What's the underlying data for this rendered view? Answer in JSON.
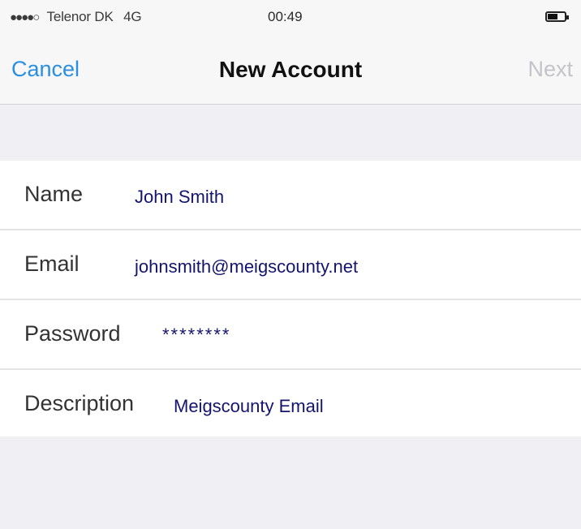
{
  "status_bar": {
    "signal": "●●●●○",
    "carrier": "Telenor DK",
    "network": "4G",
    "time": "00:49"
  },
  "nav": {
    "cancel_label": "Cancel",
    "title": "New Account",
    "next_label": "Next"
  },
  "form": {
    "name": {
      "label": "Name",
      "value": "John Smith"
    },
    "email": {
      "label": "Email",
      "value": "johnsmith@meigscounty.net"
    },
    "password": {
      "label": "Password",
      "value": "********"
    },
    "description": {
      "label": "Description",
      "value": "Meigscounty Email"
    }
  },
  "colors": {
    "accent": "#2a8fe0",
    "disabled": "#c4c4c8",
    "background": "#efeff4"
  }
}
